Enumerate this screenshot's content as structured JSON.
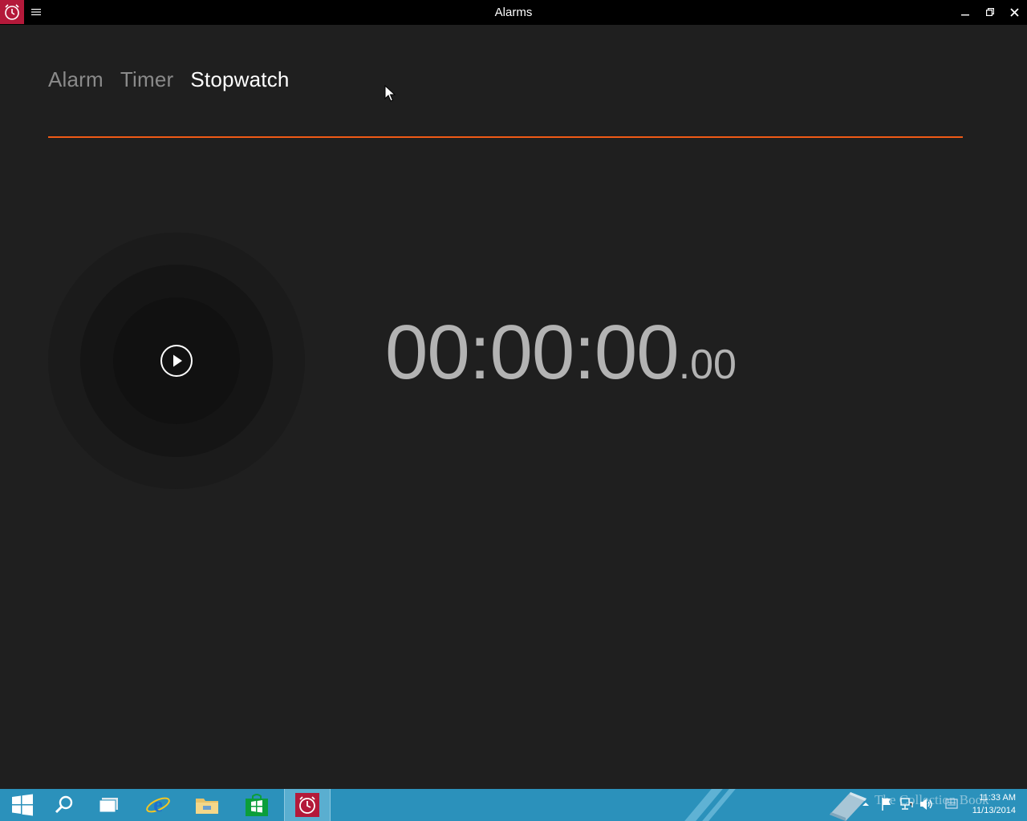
{
  "window": {
    "title": "Alarms",
    "icons": [
      "alarm-clock-icon",
      "hamburger-icon",
      "minimize-icon",
      "restore-icon",
      "close-icon"
    ]
  },
  "tabs": [
    {
      "label": "Alarm",
      "active": false
    },
    {
      "label": "Timer",
      "active": false
    },
    {
      "label": "Stopwatch",
      "active": true
    }
  ],
  "stopwatch": {
    "time_main": "00:00:00",
    "time_fraction": ".00",
    "play_icon": "play-icon"
  },
  "taskbar": {
    "apps": [
      "start-icon",
      "search-icon",
      "task-view-icon",
      "internet-explorer-icon",
      "file-explorer-icon",
      "store-icon",
      "alarms-icon"
    ],
    "watermark": "The Collection Book",
    "clock_time": "11:33 AM",
    "clock_date": "11/13/2014"
  },
  "colors": {
    "accent": "#f05a16",
    "app_icon_bg": "#b4193a",
    "taskbar": "#2b91bb",
    "background": "#1f1f1f"
  }
}
